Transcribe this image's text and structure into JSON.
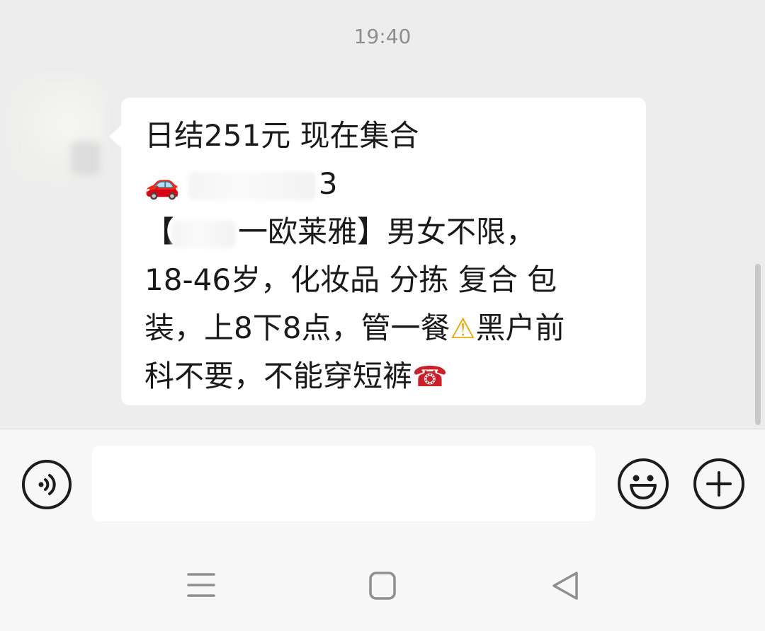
{
  "chat": {
    "timestamp": "19:40",
    "message": {
      "line1": "日结251元  现在集合",
      "line2_emoji": "🚗",
      "line2_tail": "3",
      "line3_open": "【",
      "line3_text": "一欧莱雅】男女不限，",
      "line4": "18-46岁，化妆品 分拣 复合 包",
      "line5_text": "装，上8下8点，管一餐",
      "line5_emoji": "⚠",
      "line5_tail": "黑户前",
      "line6_text": "科不要，不能穿短裤",
      "line6_emoji": "☎"
    }
  },
  "input_bar": {
    "text_value": "",
    "voice_icon": "voice-icon",
    "emoji_icon": "smiley-icon",
    "plus_icon": "plus-icon"
  },
  "nav": {
    "menu_icon": "menu-icon",
    "home_icon": "square-home-icon",
    "back_icon": "triangle-back-icon"
  }
}
